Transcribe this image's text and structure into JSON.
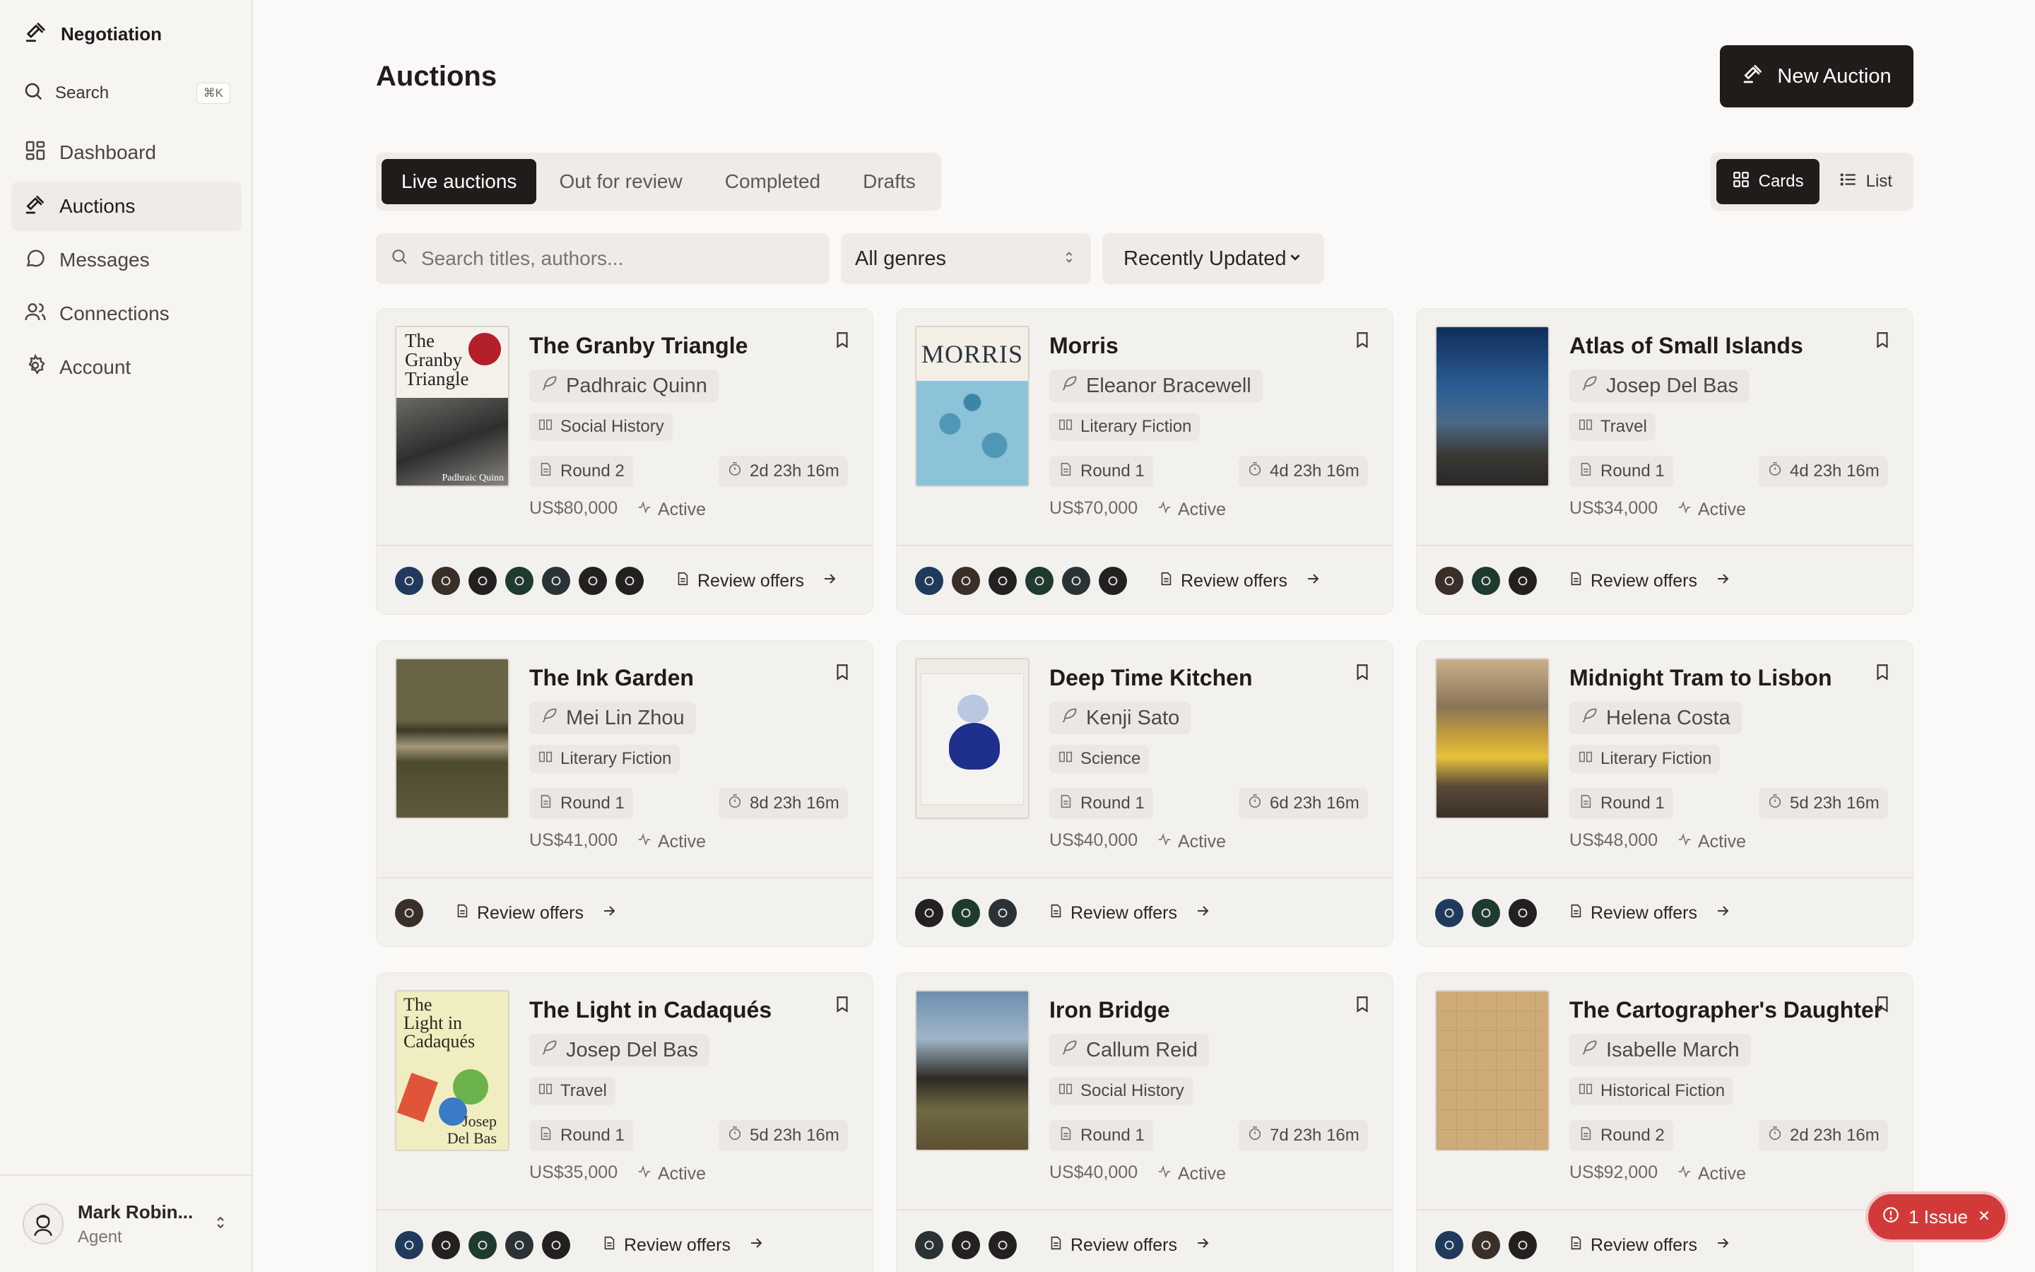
{
  "app": {
    "name": "Negotiation"
  },
  "sidebar": {
    "search_label": "Search",
    "search_shortcut": "⌘K",
    "items": [
      {
        "label": "Dashboard",
        "icon": "dashboard-icon"
      },
      {
        "label": "Auctions",
        "icon": "gavel-icon",
        "active": true
      },
      {
        "label": "Messages",
        "icon": "message-icon"
      },
      {
        "label": "Connections",
        "icon": "users-icon"
      },
      {
        "label": "Account",
        "icon": "gear-icon"
      }
    ],
    "user": {
      "name": "Mark Robin...",
      "role": "Agent"
    }
  },
  "page": {
    "title": "Auctions",
    "new_button": "New Auction"
  },
  "tabs": [
    "Live auctions",
    "Out for review",
    "Completed",
    "Drafts"
  ],
  "view": {
    "cards": "Cards",
    "list": "List",
    "selected": "Cards"
  },
  "filters": {
    "search_placeholder": "Search titles, authors...",
    "genre": "All genres",
    "sort": "Recently Updated"
  },
  "review_label": "Review offers",
  "cards": [
    {
      "title": "The Granby Triangle",
      "author": "Padhraic Quinn",
      "genre": "Social History",
      "round": "Round 2",
      "time": "2d 23h 16m",
      "price": "US$80,000",
      "status": "Active",
      "bidders": [
        "navy",
        "brown",
        "dark",
        "green",
        "slate",
        "dark",
        "dark"
      ]
    },
    {
      "title": "Morris",
      "author": "Eleanor Bracewell",
      "genre": "Literary Fiction",
      "round": "Round 1",
      "time": "4d 23h 16m",
      "price": "US$70,000",
      "status": "Active",
      "bidders": [
        "navy",
        "brown",
        "dark",
        "green",
        "slate",
        "dark"
      ]
    },
    {
      "title": "Atlas of Small Islands",
      "author": "Josep Del Bas",
      "genre": "Travel",
      "round": "Round 1",
      "time": "4d 23h 16m",
      "price": "US$34,000",
      "status": "Active",
      "bidders": [
        "brown",
        "green",
        "dark"
      ]
    },
    {
      "title": "The Ink Garden",
      "author": "Mei Lin Zhou",
      "genre": "Literary Fiction",
      "round": "Round 1",
      "time": "8d 23h 16m",
      "price": "US$41,000",
      "status": "Active",
      "bidders": [
        "brown"
      ]
    },
    {
      "title": "Deep Time Kitchen",
      "author": "Kenji Sato",
      "genre": "Science",
      "round": "Round 1",
      "time": "6d 23h 16m",
      "price": "US$40,000",
      "status": "Active",
      "bidders": [
        "dark",
        "green",
        "slate"
      ]
    },
    {
      "title": "Midnight Tram to Lisbon",
      "author": "Helena Costa",
      "genre": "Literary Fiction",
      "round": "Round 1",
      "time": "5d 23h 16m",
      "price": "US$48,000",
      "status": "Active",
      "bidders": [
        "navy",
        "green",
        "dark"
      ]
    },
    {
      "title": "The Light in Cadaqués",
      "author": "Josep Del Bas",
      "genre": "Travel",
      "round": "Round 1",
      "time": "5d 23h 16m",
      "price": "US$35,000",
      "status": "Active",
      "bidders": [
        "navy",
        "dark",
        "green",
        "slate",
        "dark"
      ]
    },
    {
      "title": "Iron Bridge",
      "author": "Callum Reid",
      "genre": "Social History",
      "round": "Round 1",
      "time": "7d 23h 16m",
      "price": "US$40,000",
      "status": "Active",
      "bidders": [
        "slate",
        "dark",
        "dark"
      ]
    },
    {
      "title": "The Cartographer's Daughter",
      "author": "Isabelle March",
      "genre": "Historical Fiction",
      "round": "Round 2",
      "time": "2d 23h 16m",
      "price": "US$92,000",
      "status": "Active",
      "bidders": [
        "navy",
        "brown",
        "dark"
      ]
    }
  ],
  "covers": {
    "granby": {
      "line1": "The",
      "line2": "Granby",
      "line3": "Triangle",
      "author": "Padhraic Quinn"
    },
    "morris": "MORRIS",
    "cadaques": {
      "line1": "The",
      "line2": "Light in",
      "line3": "Cadaqués",
      "a1": "Josep",
      "a2": "Del Bas"
    }
  },
  "issue": {
    "label": "1 Issue"
  },
  "colors": {
    "accent": "#1f1c1a",
    "issue": "#d23a3a",
    "bg": "#faf9f7",
    "card": "#f3f1ed"
  }
}
